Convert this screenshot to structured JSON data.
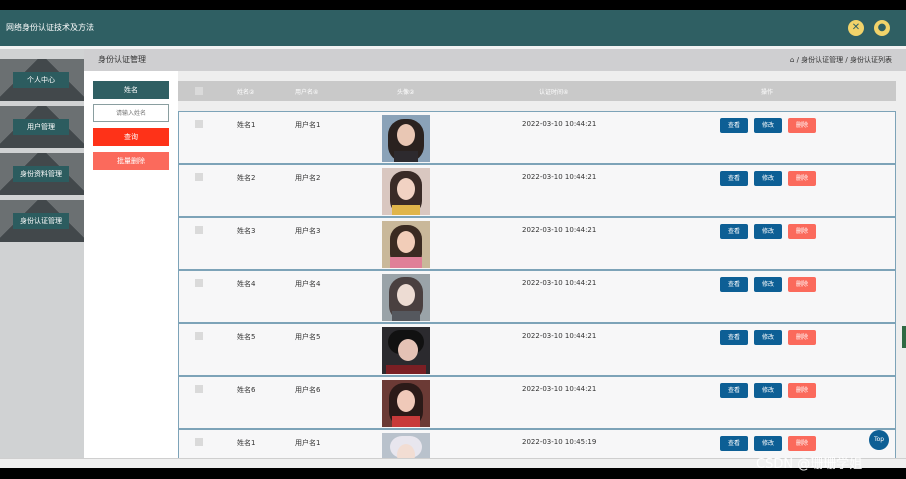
{
  "header": {
    "title": "网络身份认证技术及方法",
    "icons": [
      "close-circle-icon",
      "user-icon"
    ]
  },
  "sidebar": {
    "items": [
      {
        "label": "个人中心"
      },
      {
        "label": "用户管理"
      },
      {
        "label": "身份资料管理"
      },
      {
        "label": "身份认证管理"
      }
    ]
  },
  "breadcrumb_bar": {
    "page_title": "身份认证管理",
    "home_icon": "home-icon",
    "trail": "/ 身份认证管理 / 身份认证列表"
  },
  "filter": {
    "name_label": "姓名",
    "name_placeholder": "请输入姓名",
    "query_label": "查询",
    "batch_delete_label": "批量删除"
  },
  "table": {
    "headers": [
      "姓名②",
      "用户名④",
      "头像②",
      "认证时间④",
      "操作"
    ],
    "actions": {
      "view": "查看",
      "edit": "修改",
      "delete": "删除"
    },
    "rows": [
      {
        "name": "姓名1",
        "username": "用户名1",
        "time": "2022-03-10 10:44:21"
      },
      {
        "name": "姓名2",
        "username": "用户名2",
        "time": "2022-03-10 10:44:21"
      },
      {
        "name": "姓名3",
        "username": "用户名3",
        "time": "2022-03-10 10:44:21"
      },
      {
        "name": "姓名4",
        "username": "用户名4",
        "time": "2022-03-10 10:44:21"
      },
      {
        "name": "姓名5",
        "username": "用户名5",
        "time": "2022-03-10 10:44:21"
      },
      {
        "name": "姓名6",
        "username": "用户名6",
        "time": "2022-03-10 10:44:21"
      },
      {
        "name": "姓名1",
        "username": "用户名1",
        "time": "2022-03-10 10:45:19"
      }
    ]
  },
  "top_button": "Top",
  "watermark": "CSDN @珊珊学姐",
  "colors": {
    "header": "#2f5f63",
    "primary_button": "#0d5f95",
    "delete_button": "#fb6a5c",
    "query_button": "#fe3218"
  }
}
